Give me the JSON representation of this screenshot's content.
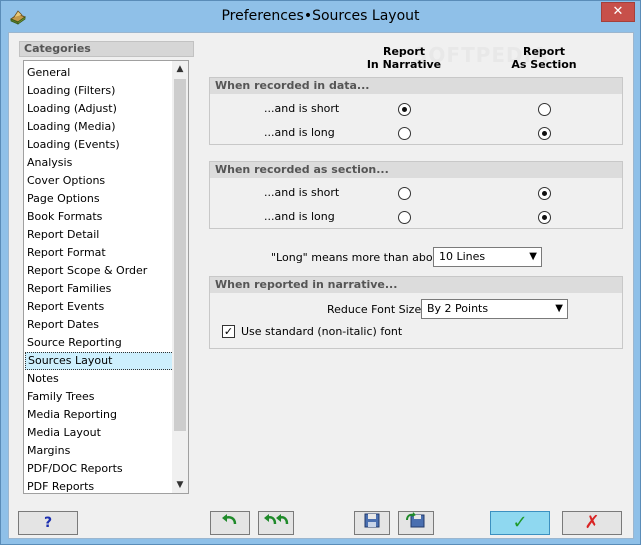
{
  "window": {
    "title": "Preferences•Sources Layout",
    "close_label": "✕"
  },
  "categories": {
    "header": "Categories",
    "items": [
      "General",
      "Loading (Filters)",
      "Loading (Adjust)",
      "Loading (Media)",
      "Loading (Events)",
      "Analysis",
      "Cover Options",
      "Page Options",
      "Book Formats",
      "Report Detail",
      "Report Format",
      "Report Scope & Order",
      "Report Families",
      "Report Events",
      "Report Dates",
      "Source Reporting",
      "Sources Layout",
      "Notes",
      "Family Trees",
      "Media Reporting",
      "Media Layout",
      "Margins",
      "PDF/DOC Reports",
      "PDF Reports"
    ],
    "selected": "Sources Layout"
  },
  "columns": {
    "narrative": "Report\nIn Narrative",
    "narrative_line1": "Report",
    "narrative_line2": "In Narrative",
    "section_line1": "Report",
    "section_line2": "As Section"
  },
  "watermark": "SOFTPEDIA",
  "recorded_in_data": {
    "title": "When recorded in data...",
    "short_label": "...and is short",
    "long_label": "...and is long",
    "short_choice": "narrative",
    "long_choice": "section"
  },
  "recorded_as_section": {
    "title": "When recorded as section...",
    "short_label": "...and is short",
    "long_label": "...and is long",
    "short_choice": "section",
    "long_choice": "section"
  },
  "long_means": {
    "label": "\"Long\" means more than about",
    "value": "10 Lines"
  },
  "narrative": {
    "title": "When reported in narrative...",
    "font_size_label": "Reduce Font Size:",
    "font_size_value": "By 2 Points",
    "standard_font_label": "Use standard (non-italic) font",
    "standard_font_checked": true
  },
  "buttons": {
    "help": "?",
    "undo": "↶",
    "undo_all": "↶↶",
    "save": "save",
    "revert": "revert",
    "ok": "✓",
    "cancel": "✗"
  },
  "colors": {
    "accent": "#8fc0e8",
    "selected": "#cdeffd",
    "ok_green": "#1f9a2a",
    "cancel_red": "#d92424",
    "help_blue": "#1c2fb0"
  }
}
